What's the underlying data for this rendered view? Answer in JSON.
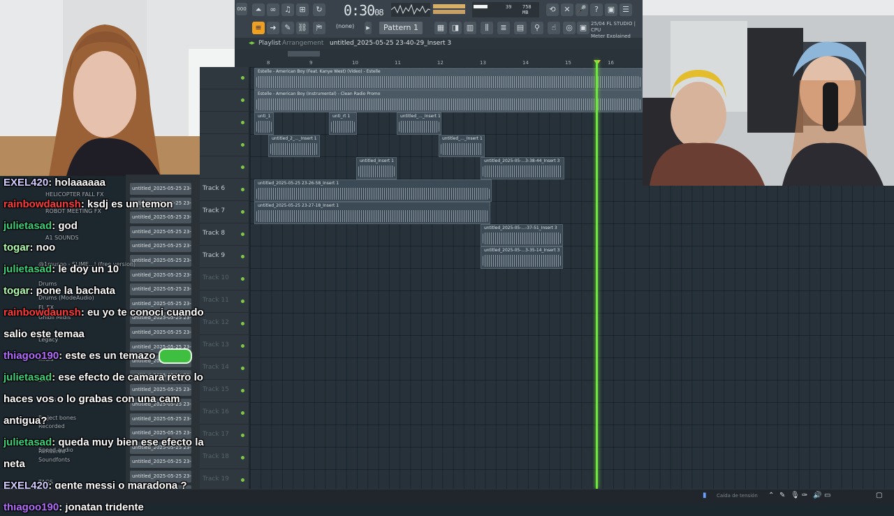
{
  "toolbar": {
    "time_main": "0:30",
    "time_sub": "08",
    "snap": "(none)",
    "pattern": "Pattern 1",
    "cpu_left": "39",
    "ram": "758 MB",
    "studio_news_line1": "25/04 FL STUDIO | CPU",
    "studio_news_line2": "Meter Explained"
  },
  "playlist": {
    "title": "Playlist",
    "subtitle": "Arrangement",
    "clip_name": "untitled_2025-05-25 23-40-29_Insert 3",
    "ruler": [
      "8",
      "9",
      "10",
      "11",
      "12",
      "13",
      "14",
      "15",
      "16"
    ],
    "tracks": [
      "",
      "",
      "",
      "",
      "",
      "Track 6",
      "Track 7",
      "Track 8",
      "Track 9",
      "Track 10",
      "Track 11",
      "Track 12",
      "Track 13",
      "Track 14",
      "Track 15",
      "Track 16",
      "Track 17",
      "Track 18",
      "Track 19"
    ],
    "clips": [
      "Estelle - American Boy (Feat. Kanye West) (Video) - Estelle",
      "Estelle - American Boy (Instrumental) - Clean Radio Promo",
      "unti_1",
      "unti_rt 1",
      "untitled_..._Insert 1",
      "untitled_2_..._Insert 1",
      "untitled_..._Insert 1",
      "untitled_insert 1",
      "untitled_2025-05-...3-38-44_Insert 3",
      "untitled_2025-05-25 23-26-58_Insert 1",
      "untitled_2025-05-25 23-27-18_Insert 1",
      "untitled_2025-05-...-37-51_Insert 3",
      "untitled_2025-05-...3-35-14_Insert 3"
    ]
  },
  "browser": {
    "items": [
      "untitled_2025-05-25 23-",
      "untitled_2025-05-25 23-",
      "untitled_2025-05-25 23-",
      "untitled_2025-05-25 23-",
      "untitled_2025-05-25 23-",
      "untitled_2025-05-25 23-",
      "untitled_2025-05-25 23-",
      "untitled_2025-05-25 23-",
      "untitled_2025-05-25 23-",
      "untitled_2025-05-25 23-",
      "untitled_2025-05-25 23-",
      "untitled_2025-05-25 23-",
      "untitled_2025-05-25 23-",
      "untitled_2025-05-25 23-",
      "untitled_2025-05-25 23-",
      "untitled_2025-05-25 23-",
      "untitled_2025-05-25 23-",
      "untitled_2025-05-25 23-",
      "untitled_2025-05-25 23-",
      "untitled_2025-05-25 23-",
      "untitled_2025-05-25 23-",
      "untitled_2025-05-25 23-"
    ],
    "overlay": [
      "HELICOPTER FALL FX",
      "ROBOT MEETING FX",
      "A1 SOUNDS",
      "@1musgo - SLIME...! (free version)",
      "Drums",
      "Drums (ModeAudio)",
      "FL EX",
      "Ghibli Midis",
      "Legacy",
      "midis",
      "SFX",
      "Vocals",
      "Project bones",
      "Recorded",
      "Rendered",
      "Speed audio",
      "Soundfonts",
      "TAGS"
    ]
  },
  "chat": [
    {
      "user": "EXEL420",
      "color": "#d2ccff",
      "text": ": holaaaaaa"
    },
    {
      "user": "rainbowdaunsh",
      "color": "#ff3b3b",
      "text": ": ksdj es un temon"
    },
    {
      "user": "julietasad",
      "color": "#3ed17a",
      "text": ": god"
    },
    {
      "user": "togar",
      "color": "#b0ffb0",
      "text": ": noo"
    },
    {
      "user": "julietasad",
      "color": "#3ed17a",
      "text": ": le doy un 10"
    },
    {
      "user": "togar",
      "color": "#b0ffb0",
      "text": ": pone la bachata"
    },
    {
      "user": "rainbowdaunsh",
      "color": "#ff3b3b",
      "text": ": eu yo te conoci cuando"
    },
    {
      "user": "",
      "color": "#ffffff",
      "text": "salio este temaa"
    },
    {
      "user": "thiagoo190",
      "color": "#b46cff",
      "text": ": este es un temazo"
    },
    {
      "user": "julietasad",
      "color": "#3ed17a",
      "text": ": ese efecto de camara retro lo"
    },
    {
      "user": "",
      "color": "#ffffff",
      "text": "haces vos o lo grabas con una cam"
    },
    {
      "user": "",
      "color": "#ffffff",
      "text": "antigua?"
    },
    {
      "user": "julietasad",
      "color": "#3ed17a",
      "text": ": queda muy bien ese efecto la"
    },
    {
      "user": "",
      "color": "#ffffff",
      "text": "neta"
    },
    {
      "user": "EXEL420",
      "color": "#d2ccff",
      "text": ": gente messi o maradona ?"
    },
    {
      "user": "thiagoo190",
      "color": "#b46cff",
      "text": ": jonatan tridente"
    }
  ],
  "taskbar": {
    "weather": "Caída de tensión"
  },
  "colors": {
    "playhead": "#6fe63a",
    "accent": "#f0a020"
  }
}
